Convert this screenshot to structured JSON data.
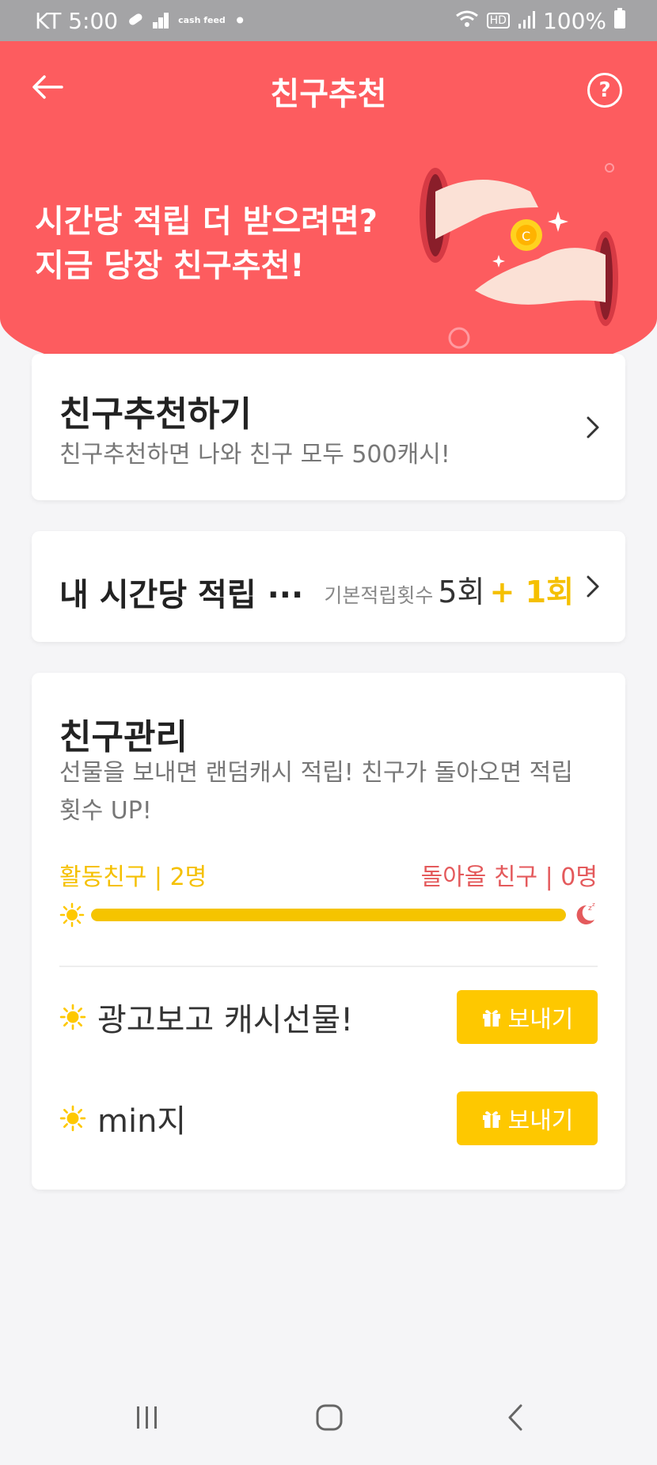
{
  "status_bar": {
    "carrier_time": "KT 5:00",
    "cash_feed": "cash feed",
    "dot": "•",
    "hd": "HD",
    "battery": "100%"
  },
  "header": {
    "title": "친구추천",
    "help": "?"
  },
  "hero": {
    "line1": "시간당 적립 더 받으려면?",
    "line2": "지금 당장 친구추천!",
    "coin_letter": "C"
  },
  "recommend_card": {
    "title": "친구추천하기",
    "subtitle": "친구추천하면 나와 친구 모두 500캐시!"
  },
  "hourly_card": {
    "title": "내 시간당 적립 ···",
    "base_label": "기본적립횟수",
    "base_count": "5회",
    "bonus_count": "+ 1회"
  },
  "friends_card": {
    "title": "친구관리",
    "description": "선물을 보내면 랜덤캐시 적립! 친구가 돌아오면 적립횟수 UP!",
    "active_friends": "활동친구 | 2명",
    "returning_friends": "돌아올 친구 | 0명",
    "progress_fraction": 1.0,
    "friends": [
      {
        "name": "광고보고 캐시선물!",
        "button": "보내기"
      },
      {
        "name": "min지",
        "button": "보내기"
      }
    ]
  },
  "colors": {
    "brand_red": "#fd5c5f",
    "accent_yellow": "#fec800",
    "return_red": "#e45a5c"
  },
  "icons": {
    "back": "arrow-left-icon",
    "help": "question-circle-icon",
    "chevron": "chevron-right-icon",
    "sun": "sun-icon",
    "moon": "moon-sleep-icon",
    "gift": "gift-icon"
  }
}
